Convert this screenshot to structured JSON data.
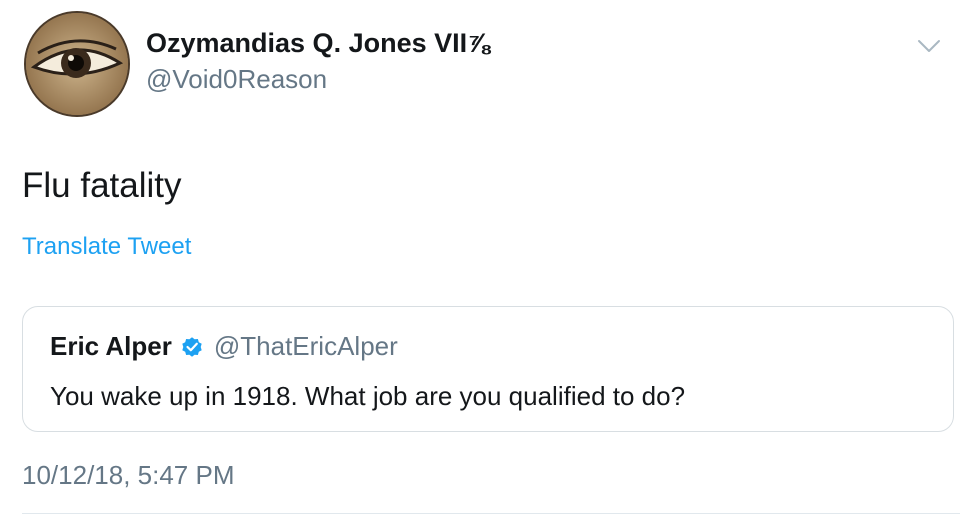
{
  "author": {
    "display_name": "Ozymandias Q. Jones VII⅞",
    "handle": "@Void0Reason",
    "avatar_icon": "eye-avatar"
  },
  "tweet": {
    "text": "Flu fatality",
    "translate_label": "Translate Tweet",
    "timestamp": "10/12/18, 5:47 PM"
  },
  "quoted_tweet": {
    "display_name": "Eric Alper",
    "verified": true,
    "handle": "@ThatEricAlper",
    "text": "You wake up in 1918. What job are you qualified to do?"
  },
  "icons": {
    "menu": "chevron-down-icon",
    "verified": "verified-badge-icon"
  },
  "colors": {
    "link": "#1da1f2",
    "secondary_text": "#657786",
    "verified_badge": "#1da1f2",
    "card_border": "#d8dee2"
  }
}
